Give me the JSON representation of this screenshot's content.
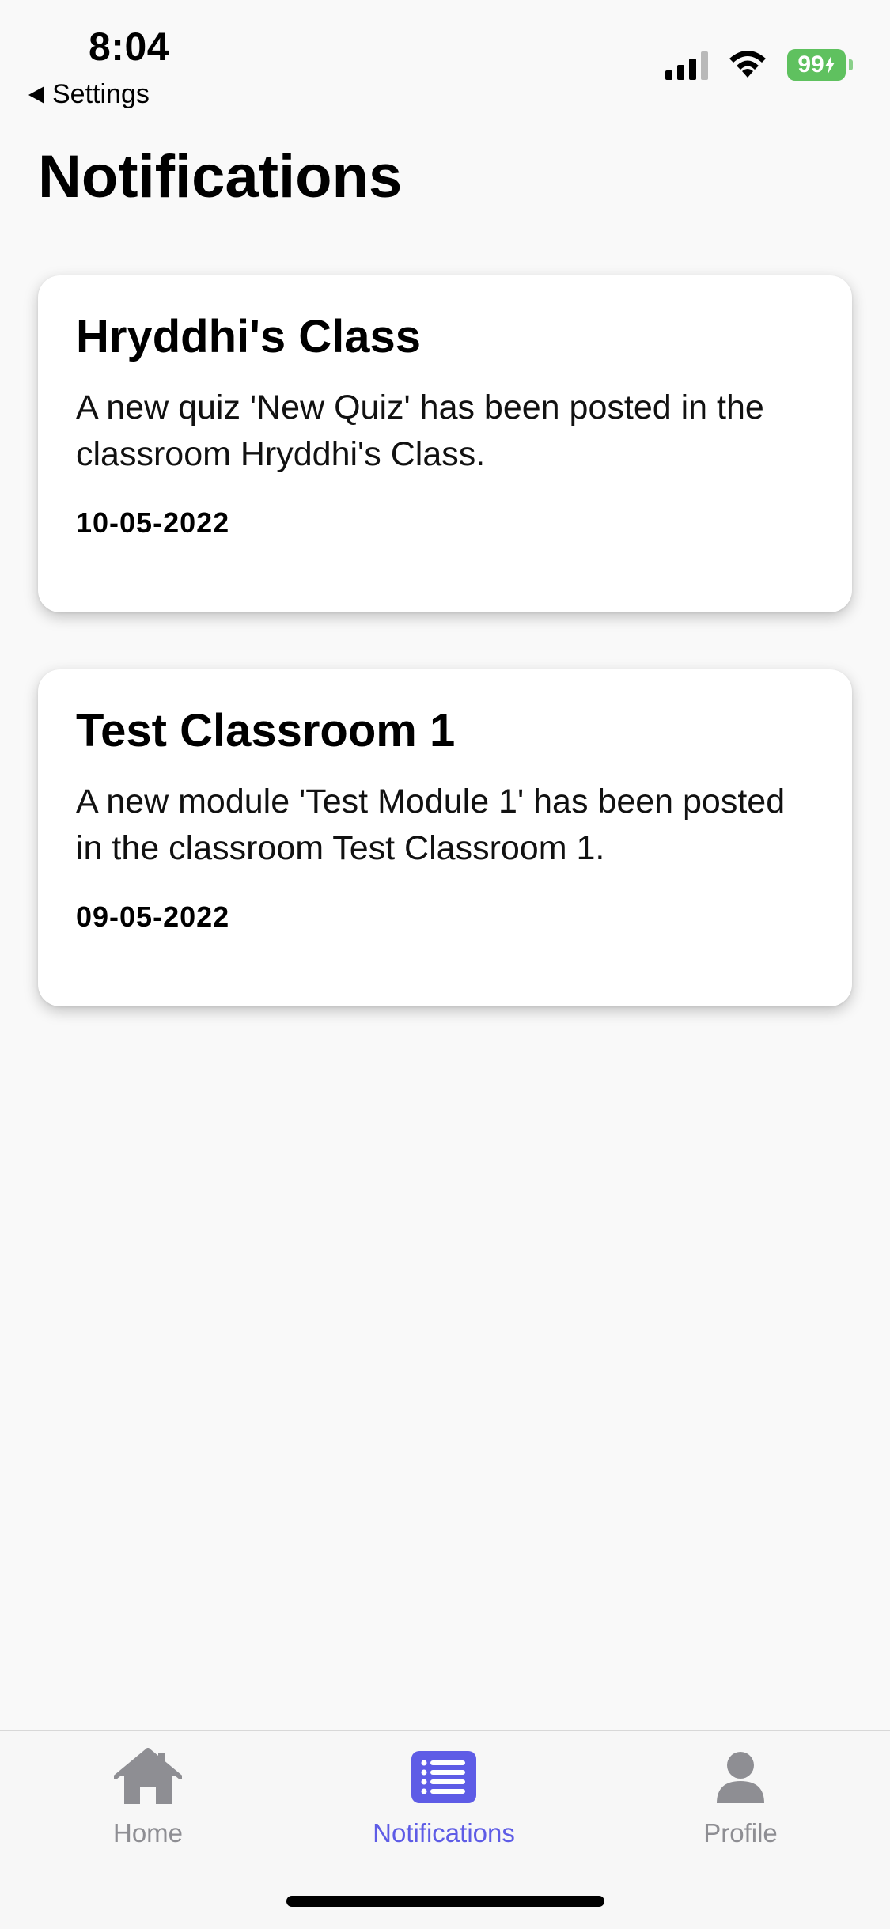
{
  "status_bar": {
    "time": "8:04",
    "back_label": "Settings",
    "battery": "99"
  },
  "page": {
    "title": "Notifications"
  },
  "notifications": [
    {
      "title": "Hryddhi's Class",
      "message": "A new quiz 'New Quiz' has been posted in the classroom Hryddhi's Class.",
      "date": "10-05-2022"
    },
    {
      "title": "Test Classroom 1",
      "message": "A new module 'Test Module 1' has been posted in the classroom Test Classroom 1.",
      "date": "09-05-2022"
    }
  ],
  "tab_bar": {
    "active": "Notifications",
    "accent_color": "#5e5ce6",
    "inactive_color": "#8e8e93",
    "items": [
      {
        "label": "Home",
        "icon": "house-icon"
      },
      {
        "label": "Notifications",
        "icon": "list-icon"
      },
      {
        "label": "Profile",
        "icon": "person-icon"
      }
    ]
  }
}
